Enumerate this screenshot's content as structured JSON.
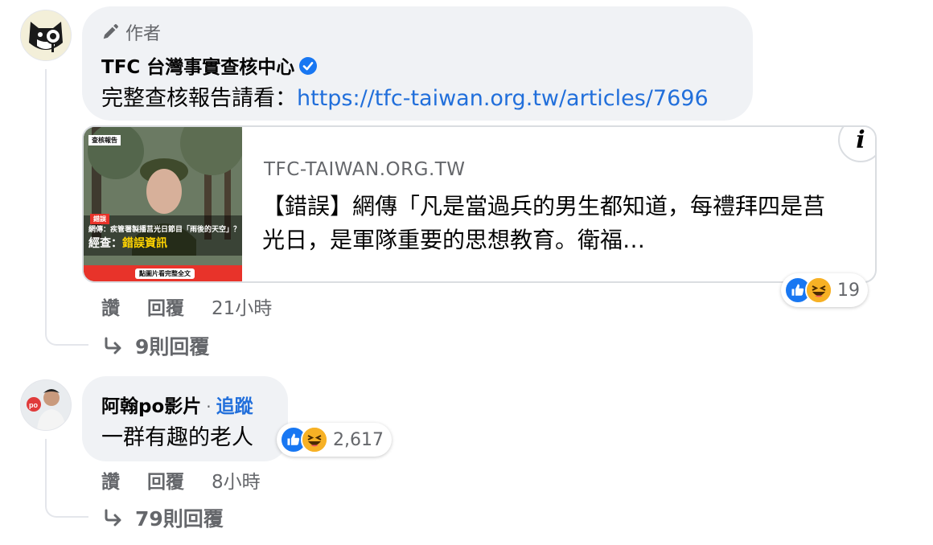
{
  "comment1": {
    "author_badge": "作者",
    "name": "TFC 台灣事實查核中心",
    "text_prefix": "完整查核報告請看：",
    "link": "https://tfc-taiwan.org.tw/articles/7696",
    "preview": {
      "domain": "TFC-TAIWAN.ORG.TW",
      "title": "【錯誤】網傳「凡是當過兵的男生都知道，每禮拜四是莒光日，是軍隊重要的思想教育。衛福…",
      "thumb_tag_top": "查核報告",
      "thumb_tag_red": "錯誤",
      "thumb_line1": "網傳：疾管署製播莒光日節目「雨後的天空」？",
      "thumb_line2_prefix": "經查：",
      "thumb_line2_hl": "錯誤資訊",
      "thumb_button": "點圖片看完整全文"
    },
    "reactions_count": "19",
    "actions": {
      "like": "讚",
      "reply": "回覆",
      "time": "21小時"
    },
    "replies": "9則回覆"
  },
  "comment2": {
    "name": "阿翰po影片",
    "follow": "追蹤",
    "text": "一群有趣的老人",
    "reactions_count": "2,617",
    "actions": {
      "like": "讚",
      "reply": "回覆",
      "time": "8小時"
    },
    "replies": "79則回覆"
  },
  "icons": {
    "pencil": "pencil-icon",
    "verified": "verified-badge-icon",
    "info": "info-icon",
    "reply_arrow": "reply-arrow-icon",
    "like": "like-reaction-icon",
    "haha": "haha-reaction-icon"
  },
  "colors": {
    "link": "#216fdb",
    "verified": "#1877f2",
    "bubble": "#f0f2f5",
    "like": "#1877f2",
    "haha": "#f7b125"
  }
}
